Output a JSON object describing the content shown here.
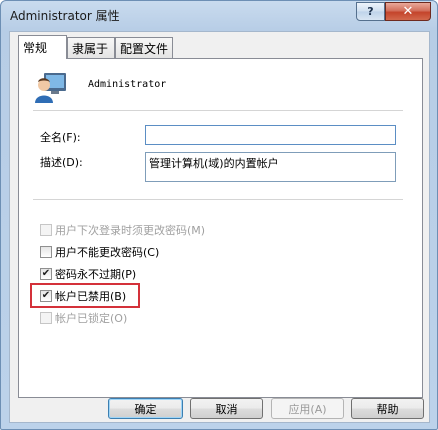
{
  "window": {
    "title": "Administrator 属性",
    "help_label": "?",
    "close_label": "✕"
  },
  "tabs": [
    {
      "label": "常规",
      "active": true
    },
    {
      "label": "隶属于",
      "active": false
    },
    {
      "label": "配置文件",
      "active": false
    }
  ],
  "general": {
    "user_icon": "user-account-icon",
    "username": "Administrator",
    "full_name_label": "全名(F):",
    "full_name_value": "",
    "description_label": "描述(D):",
    "description_value": "管理计算机(域)的内置帐户"
  },
  "checkboxes": [
    {
      "label": "用户下次登录时须更改密码(M)",
      "checked": false,
      "enabled": false
    },
    {
      "label": "用户不能更改密码(C)",
      "checked": false,
      "enabled": true
    },
    {
      "label": "密码永不过期(P)",
      "checked": true,
      "enabled": true
    },
    {
      "label": "帐户已禁用(B)",
      "checked": true,
      "enabled": true
    },
    {
      "label": "帐户已锁定(O)",
      "checked": false,
      "enabled": false
    }
  ],
  "buttons": {
    "ok": "确定",
    "cancel": "取消",
    "apply": "应用(A)",
    "help": "帮助"
  },
  "colors": {
    "highlight": "#d4313a",
    "focus_border": "#3c7fb1"
  }
}
